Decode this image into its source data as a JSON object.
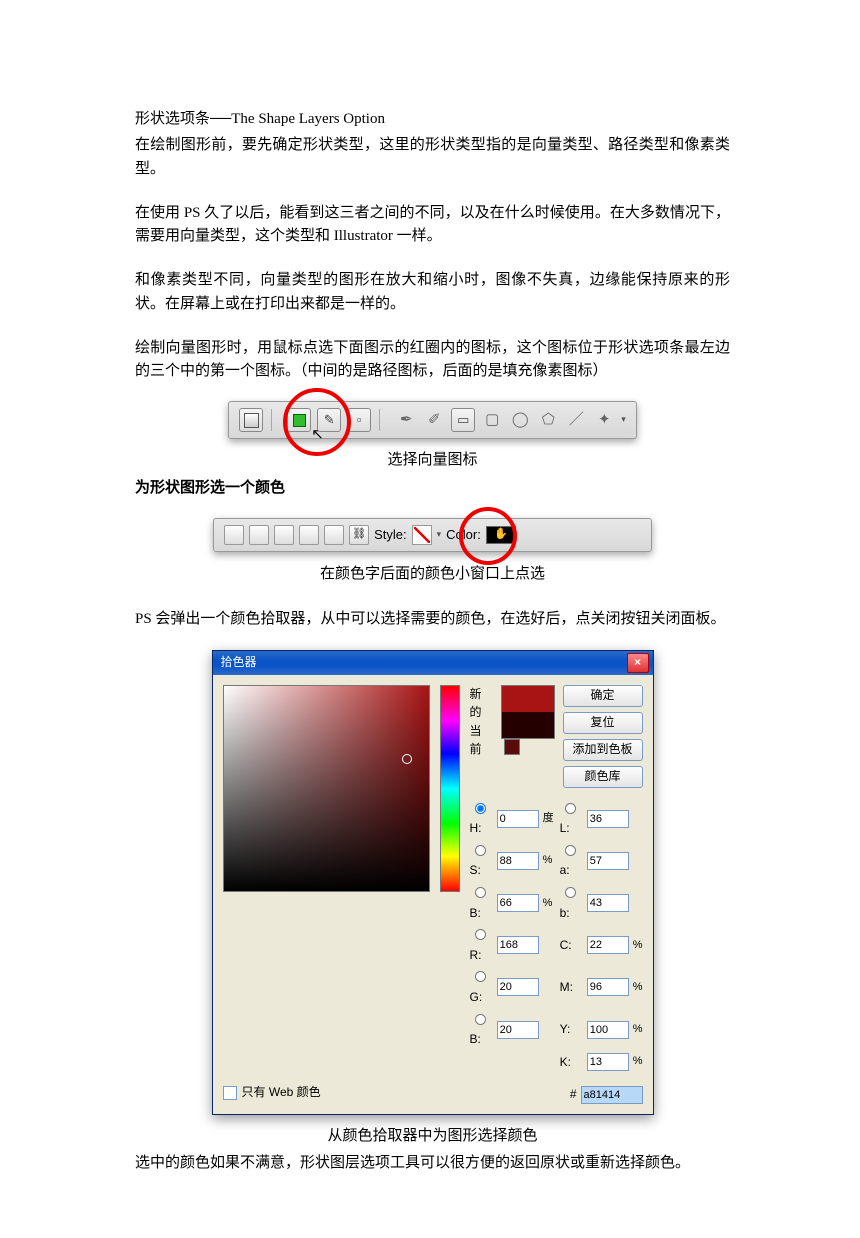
{
  "title_line": "形状选项条──The Shape Layers Option",
  "p1": "在绘制图形前，要先确定形状类型，这里的形状类型指的是向量类型、路径类型和像素类型。",
  "p2": "在使用 PS 久了以后，能看到这三者之间的不同，以及在什么时候使用。在大多数情况下，需要用向量类型，这个类型和 Illustrator 一样。",
  "p3": "和像素类型不同，向量类型的图形在放大和缩小时，图像不失真，边缘能保持原来的形状。在屏幕上或在打印出来都是一样的。",
  "p4": "绘制向量图形时，用鼠标点选下面图示的红圈内的图标，这个图标位于形状选项条最左边的三个中的第一个图标。（中间的是路径图标，后面的是填充像素图标）",
  "caption1": "选择向量图标",
  "subhead1": "为形状图形选一个颜色",
  "toolbar2": {
    "style_label": "Style:",
    "color_label": "Color:"
  },
  "caption2": "在颜色字后面的颜色小窗口上点选",
  "p5": "PS 会弹出一个颜色拾取器，从中可以选择需要的颜色，在选好后，点关闭按钮关闭面板。",
  "picker": {
    "title": "拾色器",
    "new_label": "新的",
    "current_label": "当前",
    "ok": "确定",
    "cancel": "复位",
    "add_swatch": "添加到色板",
    "color_lib": "颜色库",
    "H": {
      "label": "H:",
      "value": "0",
      "unit": "度"
    },
    "S": {
      "label": "S:",
      "value": "88",
      "unit": "%"
    },
    "B": {
      "label": "B:",
      "value": "66",
      "unit": "%"
    },
    "R": {
      "label": "R:",
      "value": "168"
    },
    "G": {
      "label": "G:",
      "value": "20"
    },
    "Bch": {
      "label": "B:",
      "value": "20"
    },
    "L": {
      "label": "L:",
      "value": "36"
    },
    "a": {
      "label": "a:",
      "value": "57"
    },
    "b": {
      "label": "b:",
      "value": "43"
    },
    "C": {
      "label": "C:",
      "value": "22",
      "unit": "%"
    },
    "M": {
      "label": "M:",
      "value": "96",
      "unit": "%"
    },
    "Y": {
      "label": "Y:",
      "value": "100",
      "unit": "%"
    },
    "K": {
      "label": "K:",
      "value": "13",
      "unit": "%"
    },
    "hex_label": "#",
    "hex": "a81414",
    "webonly": "只有 Web 颜色"
  },
  "caption3": "从颜色拾取器中为图形选择颜色",
  "p6": "选中的颜色如果不满意，形状图层选项工具可以很方便的返回原状或重新选择颜色。"
}
